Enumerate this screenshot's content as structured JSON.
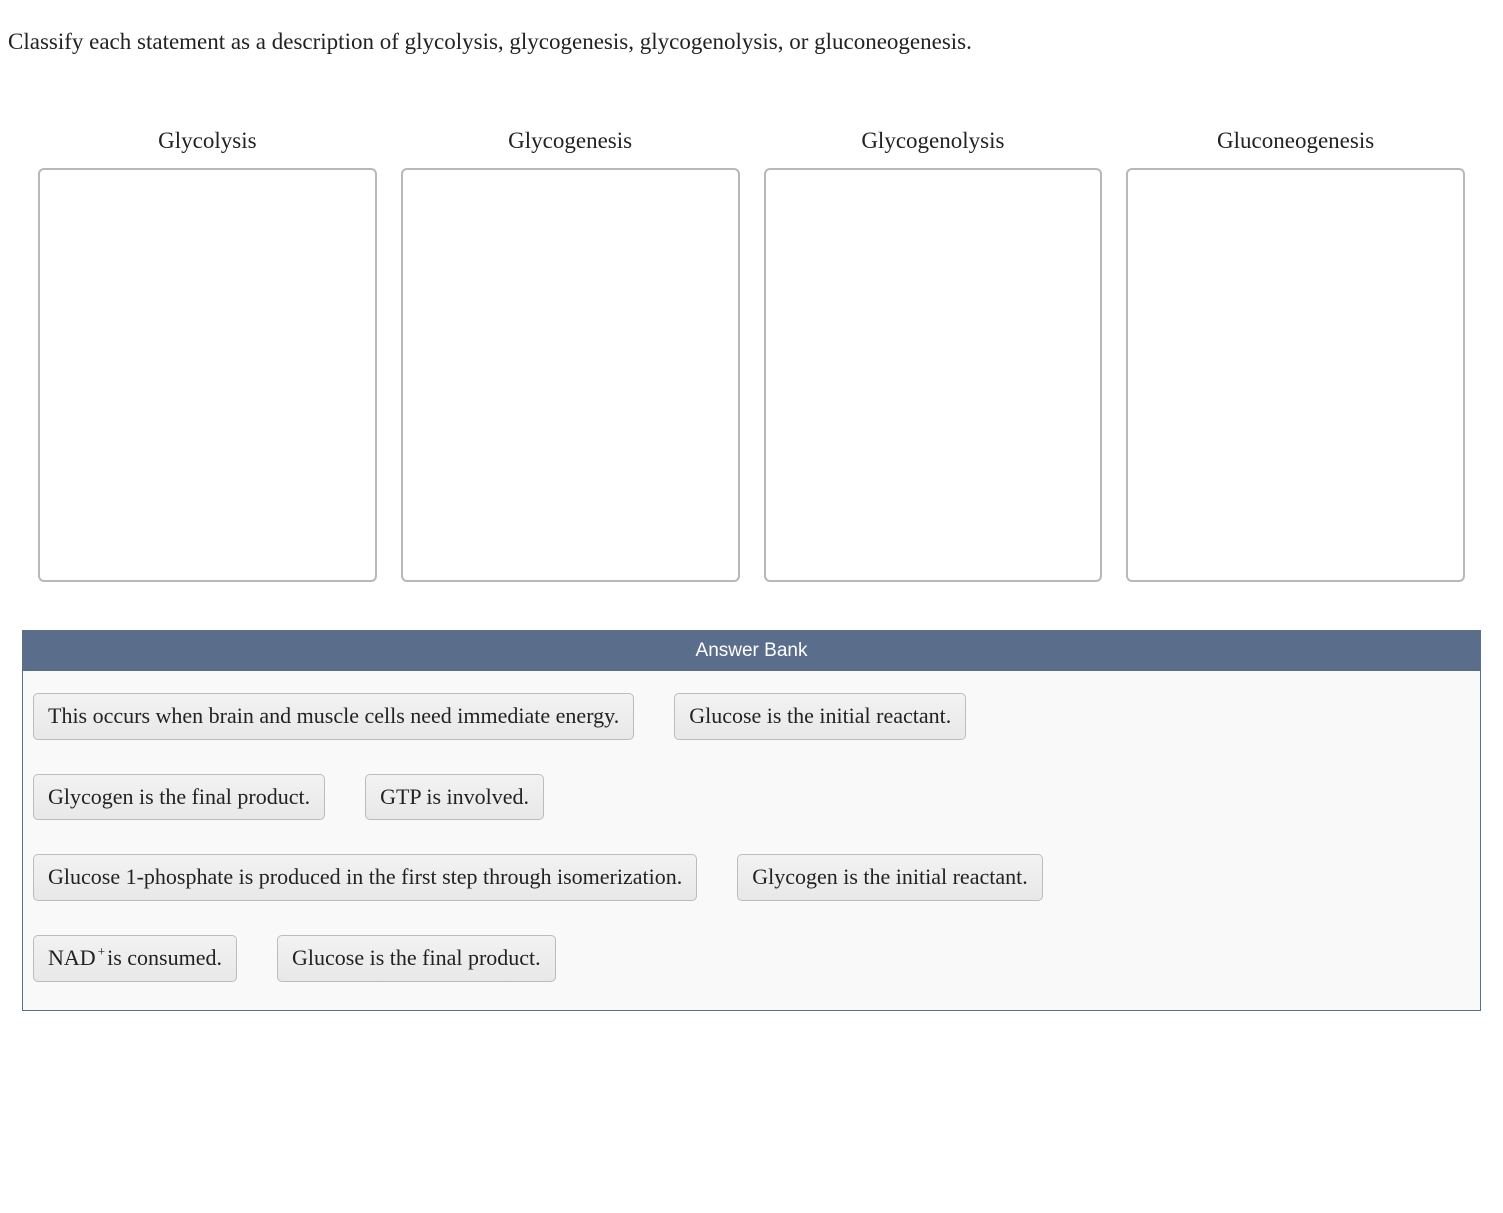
{
  "prompt": "Classify each statement as a description of glycolysis, glycogenesis, glycogenolysis, or gluconeogenesis.",
  "categories": [
    {
      "label": "Glycolysis"
    },
    {
      "label": "Glycogenesis"
    },
    {
      "label": "Glycogenolysis"
    },
    {
      "label": "Gluconeogenesis"
    }
  ],
  "bank_title": "Answer Bank",
  "bank_rows": [
    [
      {
        "text": "This occurs when brain and muscle cells need immediate energy."
      },
      {
        "text": "Glucose is the initial reactant."
      }
    ],
    [
      {
        "text": "Glycogen is the final product."
      },
      {
        "text": "GTP is involved."
      }
    ],
    [
      {
        "text": "Glucose 1-phosphate is produced in the first step through isomerization."
      },
      {
        "text": "Glycogen is the initial reactant."
      }
    ],
    [
      {
        "pre": "NAD",
        "sup": "+",
        "post": " is consumed."
      },
      {
        "text": "Glucose is the final product."
      }
    ]
  ]
}
